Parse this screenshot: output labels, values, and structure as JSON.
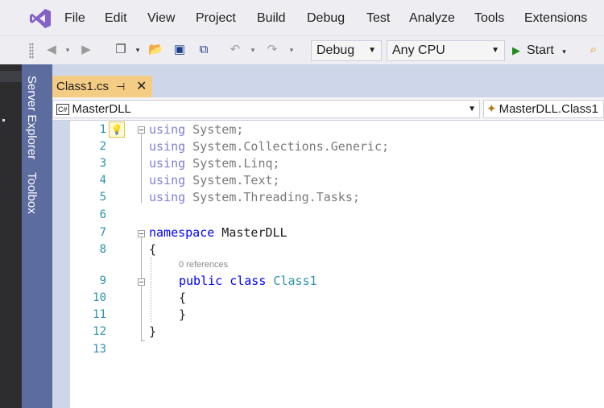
{
  "menu": [
    "File",
    "Edit",
    "View",
    "Project",
    "Build",
    "Debug",
    "Test",
    "Analyze",
    "Tools",
    "Extensions"
  ],
  "toolbar": {
    "config": "Debug",
    "platform": "Any CPU",
    "start_label": "Start"
  },
  "side_tabs": [
    "Server Explorer",
    "Toolbox"
  ],
  "document_tab": {
    "title": "Class1.cs",
    "pin_icon": "pin-icon",
    "close_icon": "close-icon"
  },
  "navbar": {
    "project": "MasterDLL",
    "class_path": "MasterDLL.Class1"
  },
  "code": {
    "line_numbers": [
      "1",
      "2",
      "3",
      "4",
      "5",
      "6",
      "7",
      "8",
      "9",
      "10",
      "11",
      "12",
      "13"
    ],
    "lines": [
      [
        "using",
        " System;"
      ],
      [
        "using",
        " System.Collections.Generic;"
      ],
      [
        "using",
        " System.Linq;"
      ],
      [
        "using",
        " System.Text;"
      ],
      [
        "using",
        " System.Threading.Tasks;"
      ]
    ],
    "namespace_kw": "namespace",
    "namespace_name": " MasterDLL",
    "open_brace": "{",
    "close_brace": "}",
    "references": "0 references",
    "class_modifier": "public",
    "class_kw": "class",
    "class_name": "Class1",
    "inner_open": "{",
    "inner_close": "}"
  },
  "colors": {
    "keyword": "#0000ff",
    "type": "#2b91af",
    "side_tab_bg": "#5c6c9e",
    "active_tab_bg": "#f5cc84"
  }
}
